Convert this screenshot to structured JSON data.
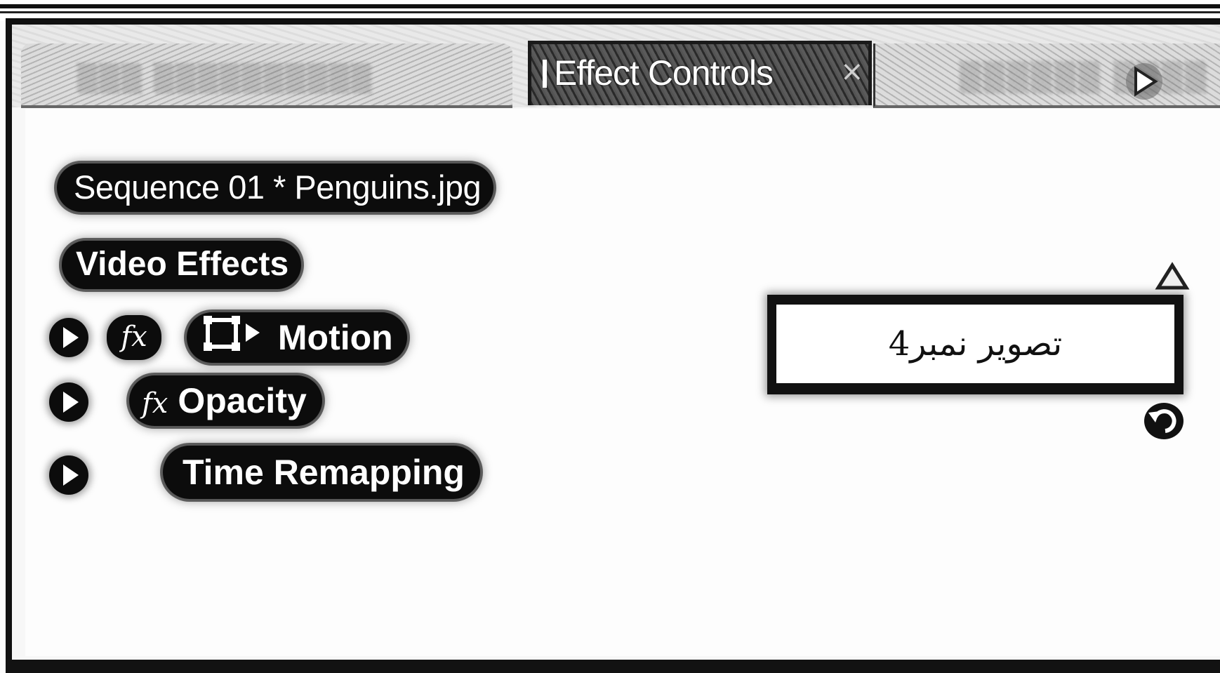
{
  "tabs": {
    "active_label": "Effect Controls",
    "active_close": "×"
  },
  "panel": {
    "sequence_title": "Sequence 01 * Penguins.jpg",
    "section_label": "Video Effects",
    "effects": [
      {
        "label": "Motion",
        "fx": "fx",
        "has_transform_icon": true
      },
      {
        "label": "Opacity",
        "fx": "fx"
      },
      {
        "label": "Time Remapping"
      }
    ]
  },
  "caption": {
    "text": "تصویر نمبر4"
  }
}
